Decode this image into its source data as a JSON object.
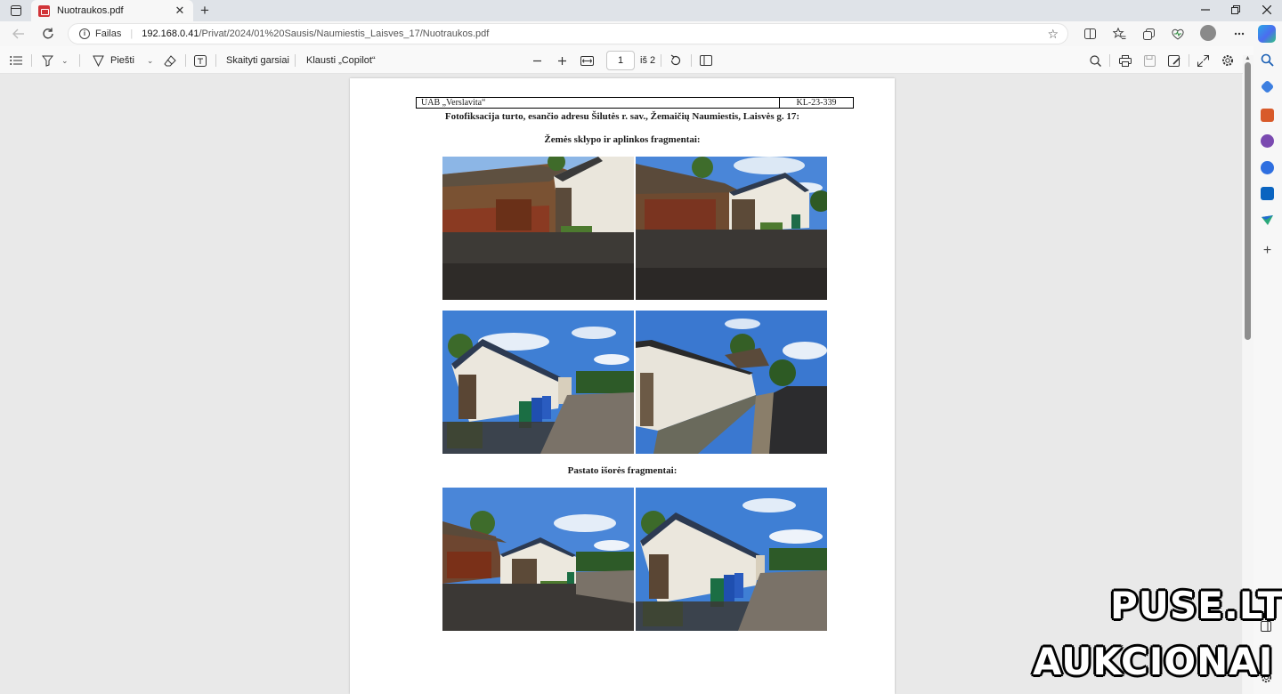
{
  "browser": {
    "tab_title": "Nuotraukos.pdf",
    "new_tab_symbol": "+",
    "close_tab_symbol": "✕",
    "url_scheme_label": "Failas",
    "url_host": "192.168.0.41",
    "url_path": "/Privat/2024/01%20Sausis/Naumiestis_Laisves_17/Nuotraukos.pdf"
  },
  "pdf_toolbar": {
    "draw_label": "Piešti",
    "read_aloud_label": "Skaityti garsiai",
    "ask_copilot_label": "Klausti „Copilot“",
    "current_page": "1",
    "page_total_label": "iš 2"
  },
  "document": {
    "header_company": "UAB „Verslavita“",
    "header_code": "KL-23-339",
    "title": "Fotofiksacija turto, esančio adresu Šilutės r. sav., Žemaičių Naumiestis, Laisvės g. 17:",
    "section_land": "Žemės sklypo ir aplinkos fragmentai:",
    "section_building": "Pastato išorės fragmentai:"
  },
  "watermark": {
    "line1": "PUSE.LT",
    "line2": "AUKCIONAI"
  },
  "colors": {
    "pdf_icon": "#d13438",
    "sky": "#4a86d8",
    "wall": "#e6e2d8",
    "ground": "#3d3a36"
  }
}
